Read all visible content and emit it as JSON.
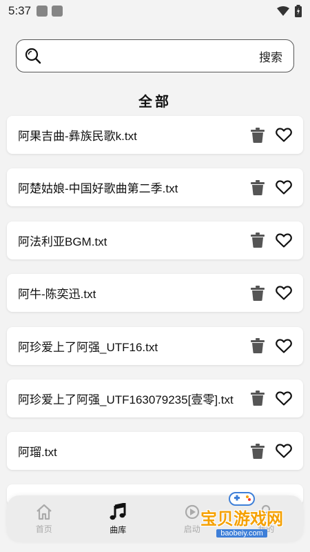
{
  "status": {
    "time": "5:37"
  },
  "search": {
    "placeholder": "",
    "button_label": "搜索"
  },
  "section": {
    "title": "全部"
  },
  "files": [
    {
      "name": "阿果吉曲-彝族民歌k.txt"
    },
    {
      "name": "阿楚姑娘-中国好歌曲第二季.txt"
    },
    {
      "name": "阿法利亚BGM.txt"
    },
    {
      "name": "阿牛-陈奕迅.txt"
    },
    {
      "name": "阿珍爱上了阿强_UTF16.txt"
    },
    {
      "name": "阿珍爱上了阿强_UTF163079235[壹零].txt"
    },
    {
      "name": "阿瑠.txt"
    }
  ],
  "nav": [
    {
      "label": "首页",
      "icon": "home-icon",
      "active": false
    },
    {
      "label": "曲库",
      "icon": "music-note-icon",
      "active": true
    },
    {
      "label": "启动",
      "icon": "launch-icon",
      "active": false
    },
    {
      "label": "我的",
      "icon": "profile-icon",
      "active": false
    }
  ],
  "watermark": {
    "title": "宝贝游戏网",
    "url": "baobeiy.com"
  }
}
